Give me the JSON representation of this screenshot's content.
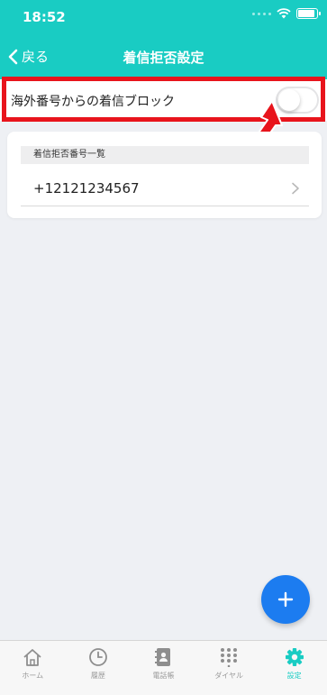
{
  "status_bar": {
    "time": "18:52"
  },
  "nav": {
    "back_label": "戻る",
    "title": "着信拒否設定"
  },
  "block_setting": {
    "label": "海外番号からの着信ブロック",
    "enabled": false
  },
  "blocked_list": {
    "header": "着信拒否番号一覧",
    "items": [
      {
        "number": "+12121234567"
      }
    ]
  },
  "fab": {
    "icon": "plus-icon"
  },
  "tabbar": {
    "tabs": [
      {
        "label": "ホーム",
        "icon": "home-icon",
        "active": false
      },
      {
        "label": "履歴",
        "icon": "clock-icon",
        "active": false
      },
      {
        "label": "電話帳",
        "icon": "contacts-icon",
        "active": false
      },
      {
        "label": "ダイヤル",
        "icon": "dialpad-icon",
        "active": false
      },
      {
        "label": "設定",
        "icon": "gear-icon",
        "active": true
      }
    ]
  },
  "colors": {
    "header": "#19ccc3",
    "accent": "#1c7cf0",
    "highlight": "#e8141c",
    "active_tab": "#19ccc3"
  }
}
